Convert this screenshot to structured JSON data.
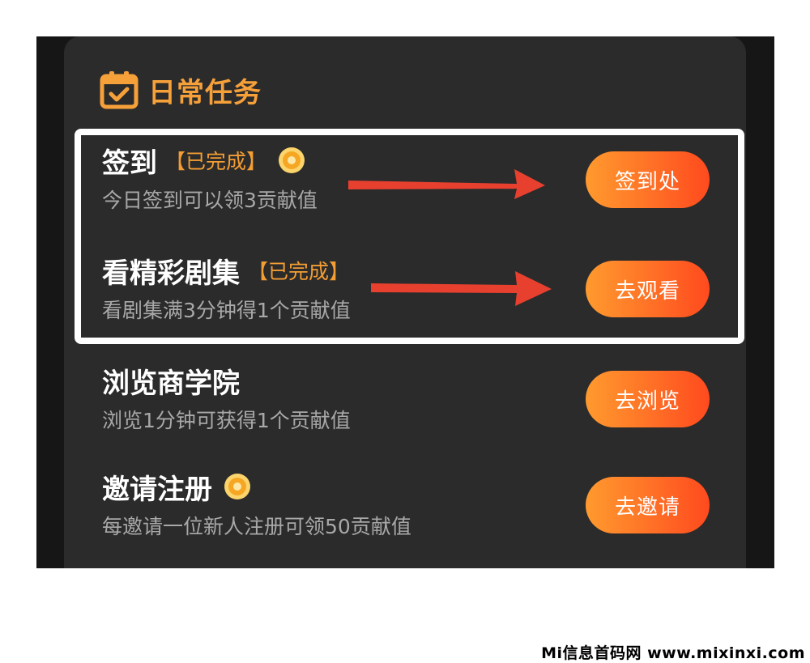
{
  "section": {
    "title": "日常任务",
    "icon": "calendar-check-icon",
    "accent": "#f6a03a"
  },
  "tasks": [
    {
      "title": "签到",
      "status": "【已完成】",
      "has_coin": true,
      "desc": "今日签到可以领3贡献值",
      "button": "签到处"
    },
    {
      "title": "看精彩剧集",
      "status": "【已完成】",
      "has_coin": false,
      "desc": "看剧集满3分钟得1个贡献值",
      "button": "去观看"
    },
    {
      "title": "浏览商学院",
      "status": "",
      "has_coin": false,
      "desc": "浏览1分钟可获得1个贡献值",
      "button": "去浏览"
    },
    {
      "title": "邀请注册",
      "status": "",
      "has_coin": true,
      "desc": "每邀请一位新人注册可领50贡献值",
      "button": "去邀请"
    }
  ],
  "watermark": "Mi信息首码网 www.mixinxi.com",
  "colors": {
    "button_start": "#ff9a2e",
    "button_end": "#ff4a1e",
    "arrow": "#e8402f",
    "highlight": "#ffffff"
  }
}
